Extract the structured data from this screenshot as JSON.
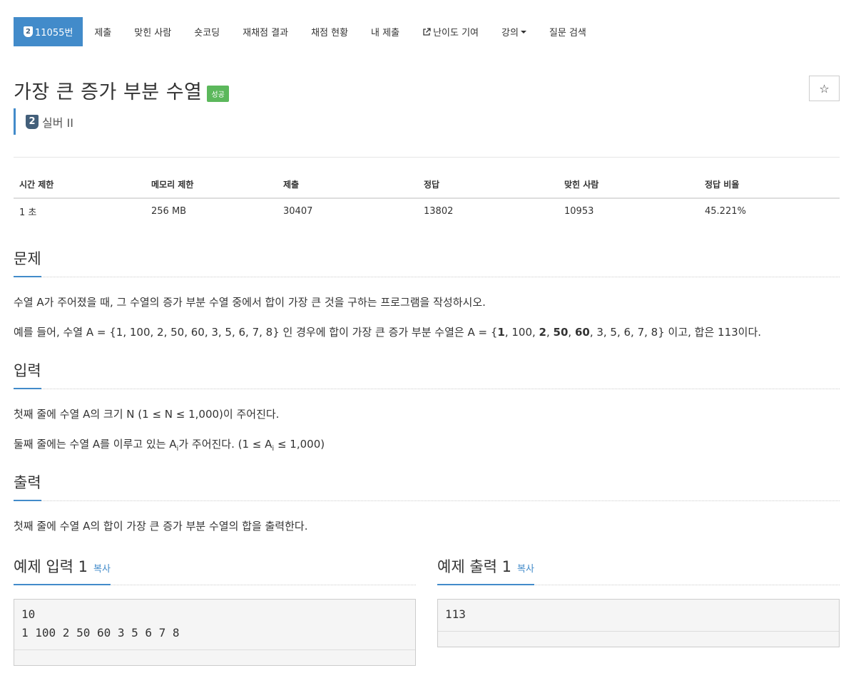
{
  "nav": {
    "tier_number": "2",
    "items": [
      "11055번",
      "제출",
      "맞힌 사람",
      "숏코딩",
      "재채점 결과",
      "채점 현황",
      "내 제출",
      "난이도 기여",
      "강의",
      "질문 검색"
    ]
  },
  "problem": {
    "title": "가장 큰 증가 부분 수열",
    "status_label": "성공",
    "tier_number": "2",
    "tier_text": "실버 II",
    "star": "☆"
  },
  "info_table": {
    "headers": [
      "시간 제한",
      "메모리 제한",
      "제출",
      "정답",
      "맞힌 사람",
      "정답 비율"
    ],
    "values": [
      "1 초",
      "256 MB",
      "30407",
      "13802",
      "10953",
      "45.221%"
    ]
  },
  "sections": {
    "problem": {
      "title": "문제",
      "p1": "수열 A가 주어졌을 때, 그 수열의 증가 부분 수열 중에서 합이 가장 큰 것을 구하는 프로그램을 작성하시오.",
      "p2_pre": "예를 들어, 수열 A = {1, 100, 2, 50, 60, 3, 5, 6, 7, 8} 인 경우에 합이 가장 큰 증가 부분 수열은 A = {",
      "b1": "1",
      "t1": ", 100, ",
      "b2": "2",
      "t2": ", ",
      "b3": "50",
      "t3": ", ",
      "b4": "60",
      "p2_post": ", 3, 5, 6, 7, 8} 이고, 합은 113이다."
    },
    "input": {
      "title": "입력",
      "p1": "첫째 줄에 수열 A의 크기 N (1 ≤ N ≤ 1,000)이 주어진다.",
      "p2_pre": "둘째 줄에는 수열 A를 이루고 있는 A",
      "p2_sub": "i",
      "p2_mid": "가 주어진다. (1 ≤ A",
      "p2_sub2": "i",
      "p2_post": " ≤ 1,000)"
    },
    "output": {
      "title": "출력",
      "p1": "첫째 줄에 수열 A의 합이 가장 큰 증가 부분 수열의 합을 출력한다."
    },
    "sample_input": {
      "title": "예제 입력 1",
      "copy": "복사",
      "content": "10\n1 100 2 50 60 3 5 6 7 8"
    },
    "sample_output": {
      "title": "예제 출력 1",
      "copy": "복사",
      "content": "113"
    }
  }
}
